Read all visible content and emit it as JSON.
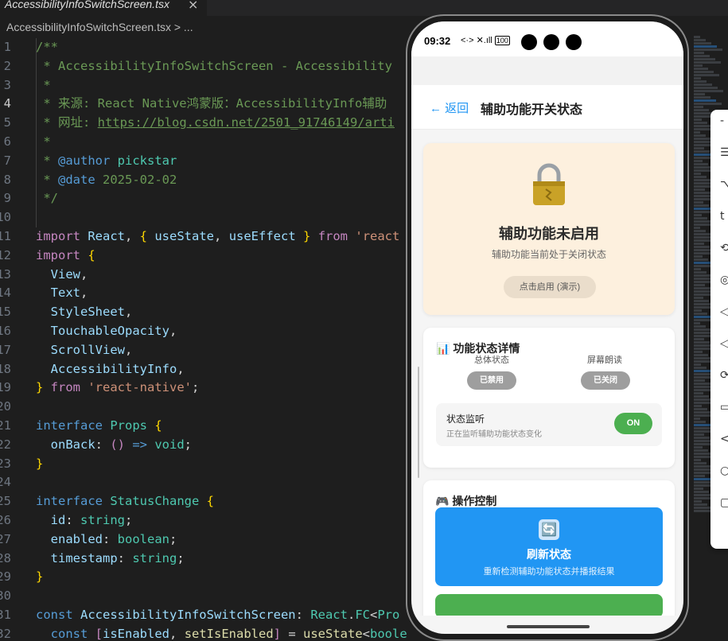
{
  "editor": {
    "tab_title": "AccessibilityInfoSwitchScreen.tsx",
    "tab_close": "×",
    "breadcrumb": "AccessibilityInfoSwitchScreen.tsx > ...",
    "lines": [
      {
        "n": "1",
        "html": "<span class='c'>/**</span>"
      },
      {
        "n": "2",
        "html": "<span class='c'> * AccessibilityInfoSwitchScreen - Accessibility</span>"
      },
      {
        "n": "3",
        "html": "<span class='c'> *</span>"
      },
      {
        "n": "4",
        "html": "<span class='c'> * 来源: React Native鸿蒙版：AccessibilityInfo辅助</span>",
        "active": true
      },
      {
        "n": "5",
        "html": "<span class='c'> * 网址: <u>https://blog.csdn.net/2501_91746149/arti</u></span>"
      },
      {
        "n": "6",
        "html": "<span class='c'> *</span>"
      },
      {
        "n": "7",
        "html": "<span class='c'> * </span><span class='k'>@author</span><span class='c'> </span><span class='t'>pickstar</span>"
      },
      {
        "n": "8",
        "html": "<span class='c'> * </span><span class='k'>@date</span><span class='c'> 2025-02-02</span>"
      },
      {
        "n": "9",
        "html": "<span class='c'> */</span>"
      },
      {
        "n": "10",
        "html": ""
      },
      {
        "n": "11",
        "html": "<span class='kc'>import</span><span class='v'> React</span><span class='p'>, </span><span class='y'>{</span><span class='v'> useState</span><span class='p'>, </span><span class='v'>useEffect </span><span class='y'>}</span><span class='kc'> from </span><span class='s'>'react</span>"
      },
      {
        "n": "12",
        "html": "<span class='kc'>import</span><span class='p'> </span><span class='y'>{</span>"
      },
      {
        "n": "13",
        "html": "<span class='v'>  View</span><span class='p'>,</span>"
      },
      {
        "n": "14",
        "html": "<span class='v'>  Text</span><span class='p'>,</span>"
      },
      {
        "n": "15",
        "html": "<span class='v'>  StyleSheet</span><span class='p'>,</span>"
      },
      {
        "n": "16",
        "html": "<span class='v'>  TouchableOpacity</span><span class='p'>,</span>"
      },
      {
        "n": "17",
        "html": "<span class='v'>  ScrollView</span><span class='p'>,</span>"
      },
      {
        "n": "18",
        "html": "<span class='v'>  AccessibilityInfo</span><span class='p'>,</span>"
      },
      {
        "n": "19",
        "html": "<span class='y'>}</span><span class='kc'> from </span><span class='s'>'react-native'</span><span class='p'>;</span>"
      },
      {
        "n": "20",
        "html": ""
      },
      {
        "n": "21",
        "html": "<span class='k'>interface</span><span class='t'> Props </span><span class='y'>{</span>"
      },
      {
        "n": "22",
        "html": "<span class='v'>  onBack</span><span class='p'>: </span><span class='kc'>()</span><span class='k'> => </span><span class='t'>void</span><span class='p'>;</span>"
      },
      {
        "n": "23",
        "html": "<span class='y'>}</span>"
      },
      {
        "n": "24",
        "html": ""
      },
      {
        "n": "25",
        "html": "<span class='k'>interface</span><span class='t'> StatusChange </span><span class='y'>{</span>"
      },
      {
        "n": "26",
        "html": "<span class='v'>  id</span><span class='p'>: </span><span class='t'>string</span><span class='p'>;</span>"
      },
      {
        "n": "27",
        "html": "<span class='v'>  enabled</span><span class='p'>: </span><span class='t'>boolean</span><span class='p'>;</span>"
      },
      {
        "n": "28",
        "html": "<span class='v'>  timestamp</span><span class='p'>: </span><span class='t'>string</span><span class='p'>;</span>"
      },
      {
        "n": "29",
        "html": "<span class='y'>}</span>"
      },
      {
        "n": "30",
        "html": ""
      },
      {
        "n": "31",
        "html": "<span class='k'>const</span><span class='v'> AccessibilityInfoSwitchScreen</span><span class='p'>: </span><span class='t'>React</span><span class='p'>.</span><span class='t'>FC</span><span class='p'>&lt;</span><span class='t'>Pro</span>"
      },
      {
        "n": "32",
        "html": "<span class='k'>  const</span><span class='p'> </span><span class='kc'>[</span><span class='v'>isEnabled</span><span class='p'>, </span><span class='f'>setIsEnabled</span><span class='kc'>]</span><span class='p'> = </span><span class='f'>useState</span><span class='p'>&lt;</span><span class='t'>boole</span>"
      }
    ]
  },
  "phone": {
    "time": "09:32",
    "status_icons": "<·> ✕.ıll",
    "battery": "100",
    "header": {
      "back_label": "← 返回",
      "title": "辅助功能开关状态"
    },
    "hero": {
      "title": "辅助功能未启用",
      "subtitle": "辅助功能当前处于关闭状态",
      "button": "点击启用 (演示)"
    },
    "detail": {
      "title": "📊 功能状态详情",
      "overall_label": "总体状态",
      "overall_value": "已禁用",
      "reader_label": "屏幕朗读",
      "reader_value": "已关闭",
      "monitor_title": "状态监听",
      "monitor_sub": "正在监听辅助功能状态变化",
      "monitor_toggle": "ON"
    },
    "ops": {
      "title": "🎮 操作控制",
      "refresh_title": "刷新状态",
      "refresh_sub": "重新检测辅助功能状态并播报结果",
      "refresh_icon": "🔄"
    }
  },
  "popup_icons": [
    "-",
    "☰",
    "⌥",
    "t",
    "⟲",
    "◎",
    "◁",
    "◁",
    "⟳",
    "▭",
    "<",
    "○",
    "▢"
  ],
  "colors": {
    "accent": "#2196f3",
    "success": "#4caf50",
    "hero_bg": "#fdf0de",
    "disabled": "#9e9e9e"
  }
}
